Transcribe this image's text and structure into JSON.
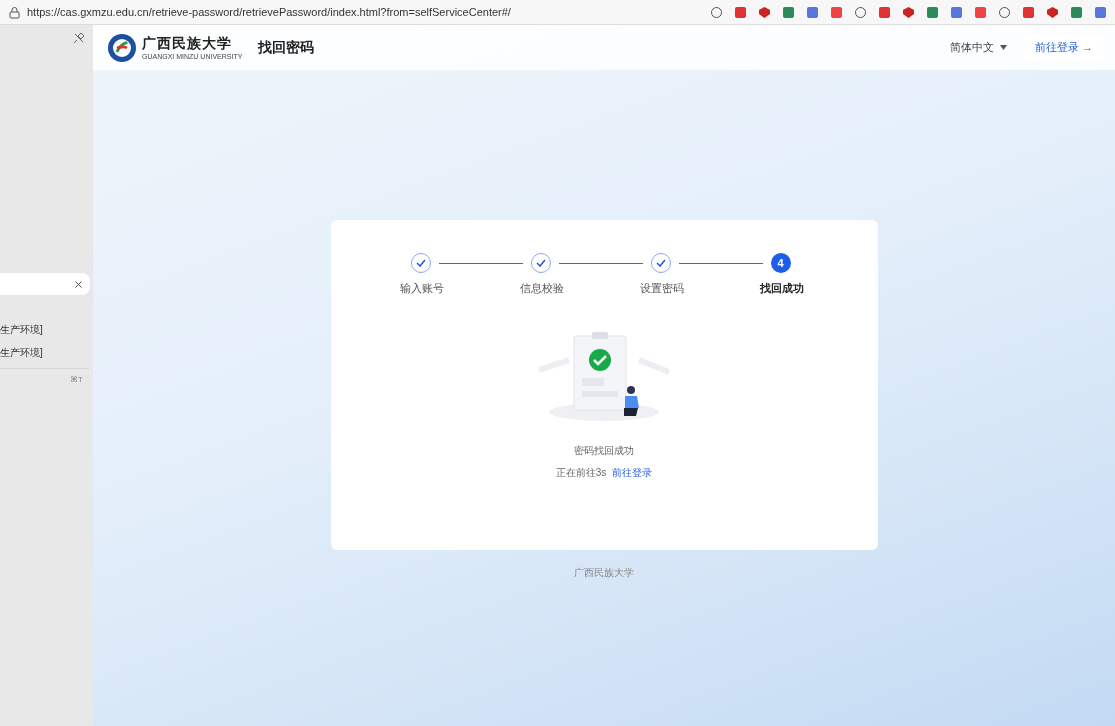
{
  "browser": {
    "url": "https://cas.gxmzu.edu.cn/retrieve-password/retrievePassword/index.html?from=selfServiceCenter#/"
  },
  "sidebar": {
    "items": [
      {
        "label": "生产环境]"
      },
      {
        "label": "生产环境]"
      }
    ],
    "shortcut": "⌘T"
  },
  "header": {
    "logo_name": "广西民族大学",
    "logo_subtitle": "GUANGXI MINZU UNIVERSITY",
    "title": "找回密码",
    "language": "简体中文",
    "login_button": "前往登录 →"
  },
  "steps": [
    {
      "label": "输入账号",
      "kind": "done",
      "selected": false
    },
    {
      "label": "信息校验",
      "kind": "done",
      "selected": false
    },
    {
      "label": "设置密码",
      "kind": "done",
      "selected": false
    },
    {
      "label": "找回成功",
      "kind": "current",
      "number": "4",
      "selected": true
    }
  ],
  "result": {
    "message": "密码找回成功",
    "countdown": "正在前往3s",
    "link": "前往登录"
  },
  "footer": "广西民族大学"
}
